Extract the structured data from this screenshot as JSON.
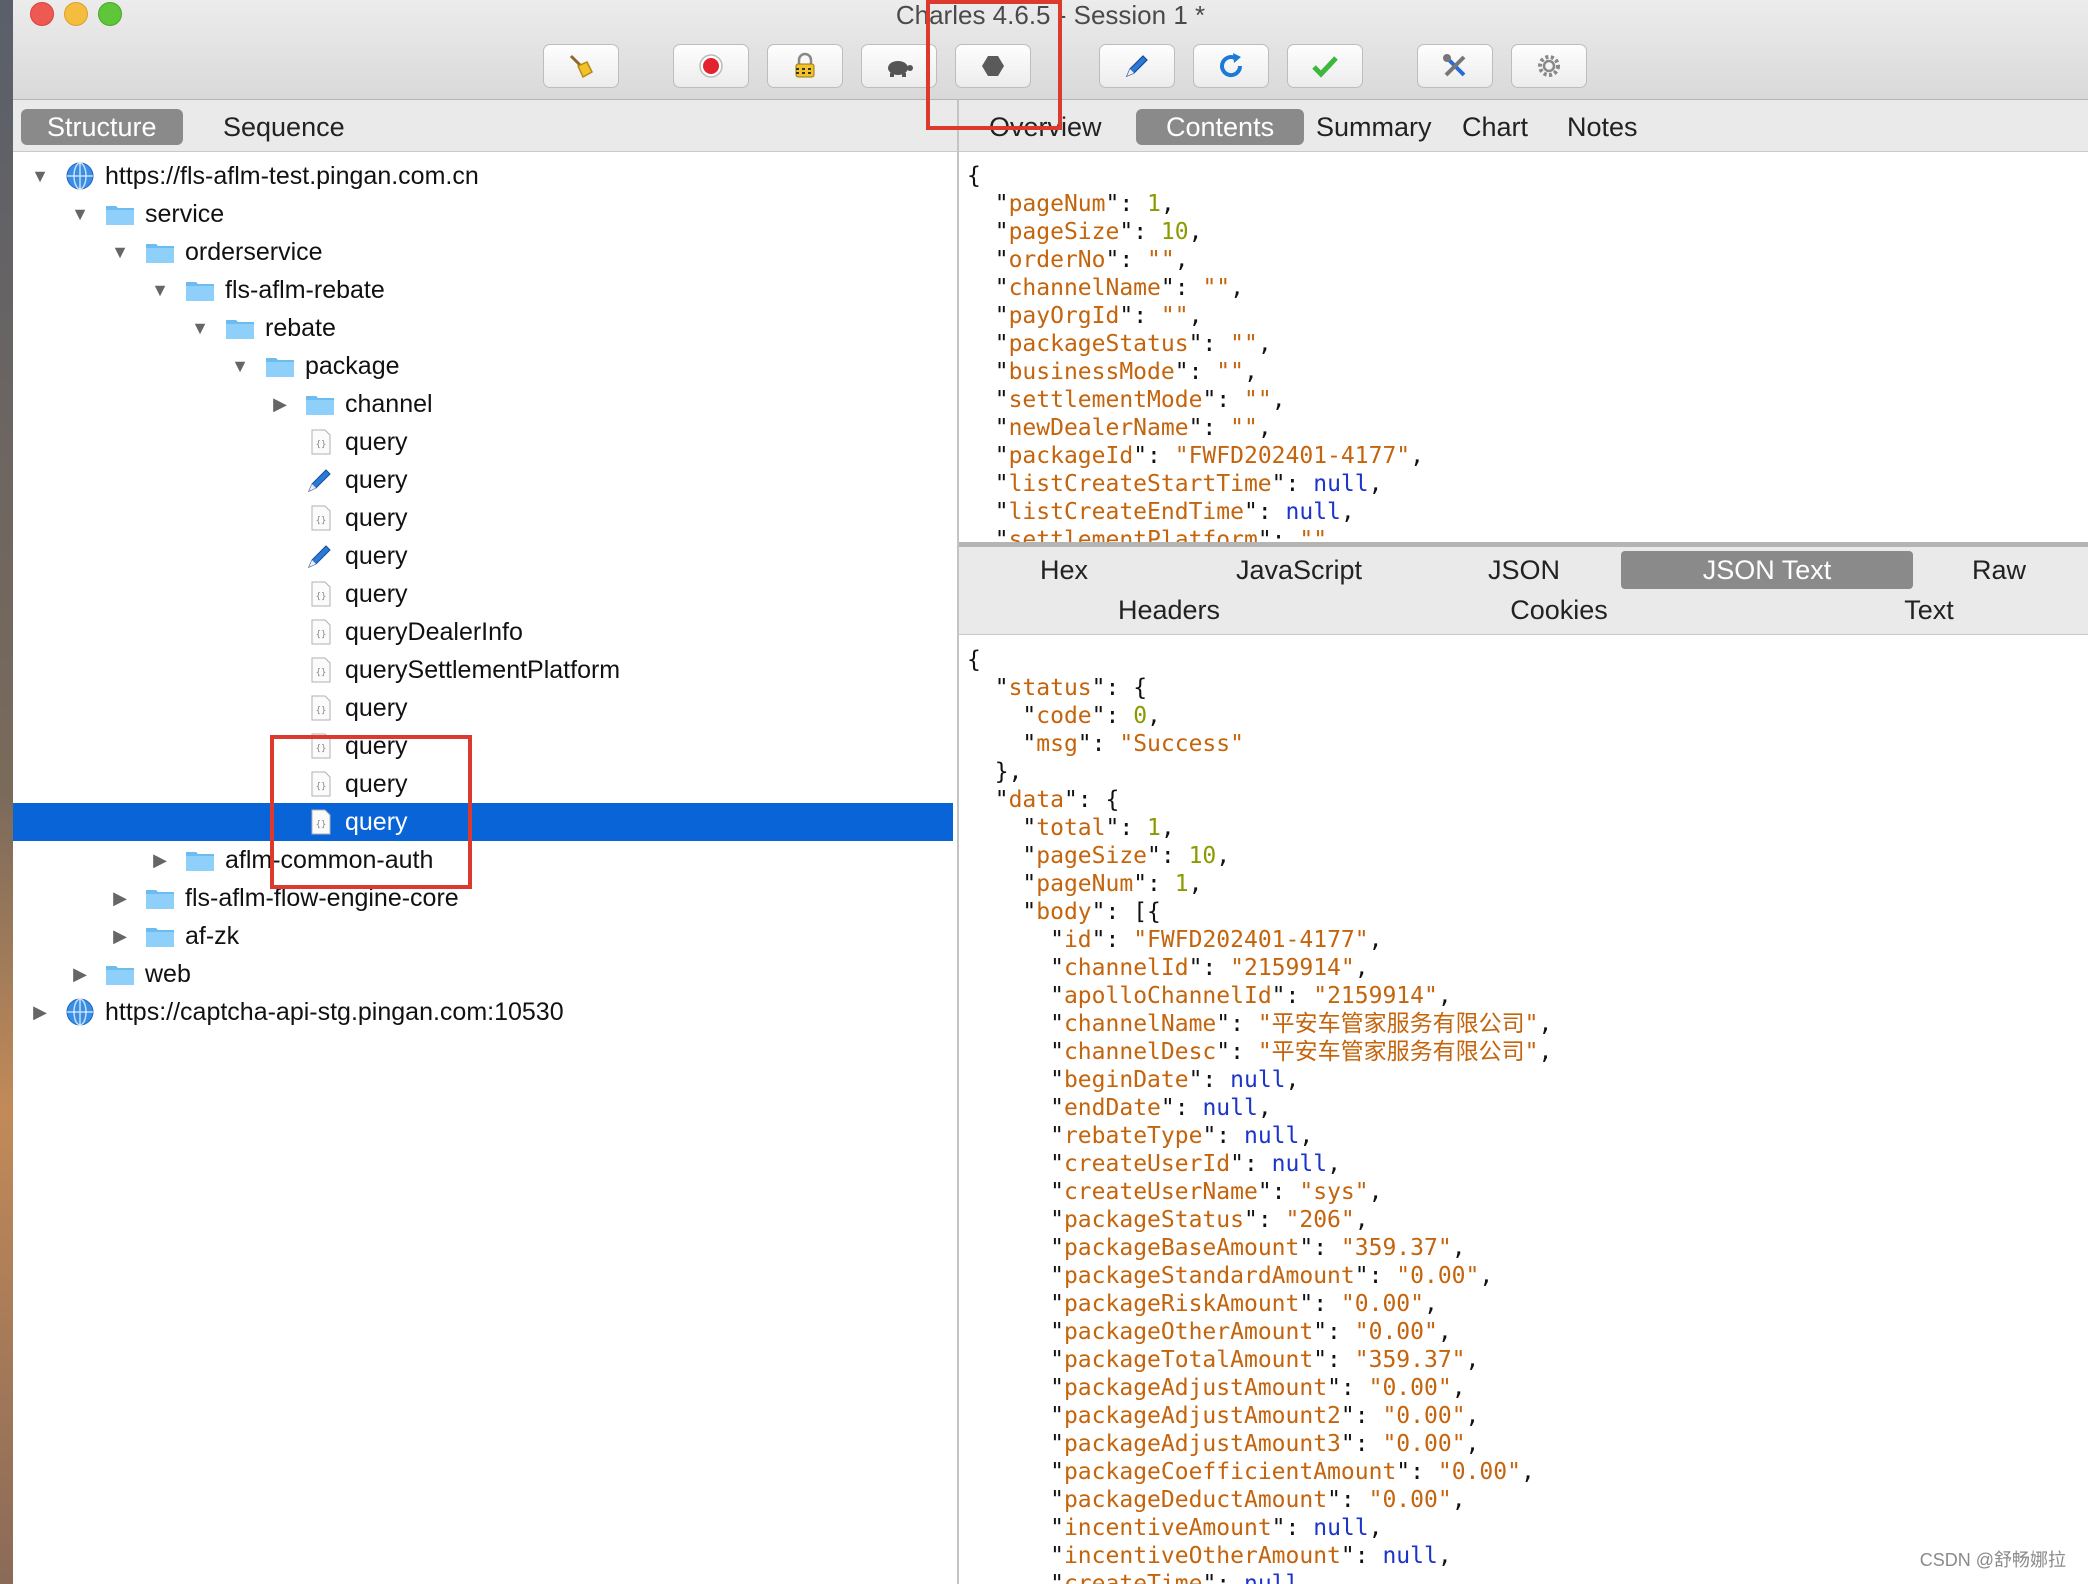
{
  "window": {
    "title": "Charles 4.6.5 - Session 1 *"
  },
  "left_tabs": [
    "Structure",
    "Sequence"
  ],
  "right_tabs": [
    "Overview",
    "Contents",
    "Summary",
    "Chart",
    "Notes"
  ],
  "toolbar": [
    "broom-icon",
    "record-icon",
    "ssl-lock-icon",
    "throttle-turtle-icon",
    "breakpoint-hexagon-icon",
    "compose-pen-icon",
    "repeat-icon",
    "validate-check-icon",
    "tools-icon",
    "settings-gear-icon"
  ],
  "tree": [
    {
      "depth": 0,
      "exp": "open",
      "icon": "globe",
      "label": "https://fls-aflm-test.pingan.com.cn"
    },
    {
      "depth": 1,
      "exp": "open",
      "icon": "folder",
      "label": "service"
    },
    {
      "depth": 2,
      "exp": "open",
      "icon": "folder",
      "label": "orderservice"
    },
    {
      "depth": 3,
      "exp": "open",
      "icon": "folder",
      "label": "fls-aflm-rebate"
    },
    {
      "depth": 4,
      "exp": "open",
      "icon": "folder",
      "label": "rebate"
    },
    {
      "depth": 5,
      "exp": "open",
      "icon": "folder",
      "label": "package"
    },
    {
      "depth": 6,
      "exp": "closed",
      "icon": "folder",
      "label": "channel"
    },
    {
      "depth": 6,
      "exp": "none",
      "icon": "json",
      "label": "query"
    },
    {
      "depth": 6,
      "exp": "none",
      "icon": "pen",
      "label": "query"
    },
    {
      "depth": 6,
      "exp": "none",
      "icon": "json",
      "label": "query"
    },
    {
      "depth": 6,
      "exp": "none",
      "icon": "pen",
      "label": "query"
    },
    {
      "depth": 6,
      "exp": "none",
      "icon": "json",
      "label": "query"
    },
    {
      "depth": 6,
      "exp": "none",
      "icon": "json",
      "label": "queryDealerInfo"
    },
    {
      "depth": 6,
      "exp": "none",
      "icon": "json",
      "label": "querySettlementPlatform"
    },
    {
      "depth": 6,
      "exp": "none",
      "icon": "json",
      "label": "query"
    },
    {
      "depth": 6,
      "exp": "none",
      "icon": "json",
      "label": "query"
    },
    {
      "depth": 6,
      "exp": "none",
      "icon": "json",
      "label": "query"
    },
    {
      "depth": 6,
      "exp": "none",
      "icon": "json",
      "label": "query",
      "selected": true
    },
    {
      "depth": 3,
      "exp": "closed",
      "icon": "folder",
      "label": "aflm-common-auth"
    },
    {
      "depth": 2,
      "exp": "closed",
      "icon": "folder",
      "label": "fls-aflm-flow-engine-core"
    },
    {
      "depth": 2,
      "exp": "closed",
      "icon": "folder",
      "label": "af-zk"
    },
    {
      "depth": 1,
      "exp": "closed",
      "icon": "folder",
      "label": "web"
    },
    {
      "depth": 0,
      "exp": "closed",
      "icon": "globe",
      "label": "https://captcha-api-stg.pingan.com:10530"
    }
  ],
  "request_json": [
    [
      "p",
      "{"
    ],
    [
      "kv",
      "pageNum",
      "1",
      "n",
      1,
      ","
    ],
    [
      "kv",
      "pageSize",
      "10",
      "n",
      1,
      ","
    ],
    [
      "kv",
      "orderNo",
      "\"\"",
      "s",
      1,
      ","
    ],
    [
      "kv",
      "channelName",
      "\"\"",
      "s",
      1,
      ","
    ],
    [
      "kv",
      "payOrgId",
      "\"\"",
      "s",
      1,
      ","
    ],
    [
      "kv",
      "packageStatus",
      "\"\"",
      "s",
      1,
      ","
    ],
    [
      "kv",
      "businessMode",
      "\"\"",
      "s",
      1,
      ","
    ],
    [
      "kv",
      "settlementMode",
      "\"\"",
      "s",
      1,
      ","
    ],
    [
      "kv",
      "newDealerName",
      "\"\"",
      "s",
      1,
      ","
    ],
    [
      "kv",
      "packageId",
      "\"FWFD202401-4177\"",
      "s",
      1,
      ","
    ],
    [
      "kv",
      "listCreateStartTime",
      "null",
      "nl",
      1,
      ","
    ],
    [
      "kv",
      "listCreateEndTime",
      "null",
      "nl",
      1,
      ","
    ],
    [
      "kv",
      "settlementPlatform",
      "\"\"",
      "s",
      1,
      ""
    ]
  ],
  "response_tabs_row1": [
    "Hex",
    "JavaScript",
    "JSON",
    "JSON Text",
    "Raw"
  ],
  "response_tabs_row2": [
    "Headers",
    "Cookies",
    "Text"
  ],
  "response_json": [
    [
      "p",
      "{"
    ],
    [
      "ko",
      "status",
      "{",
      1
    ],
    [
      "kv",
      "code",
      "0",
      "n",
      2,
      ","
    ],
    [
      "kv",
      "msg",
      "\"Success\"",
      "s",
      2,
      ""
    ],
    [
      "p",
      "  },"
    ],
    [
      "ko",
      "data",
      "{",
      1
    ],
    [
      "kv",
      "total",
      "1",
      "n",
      2,
      ","
    ],
    [
      "kv",
      "pageSize",
      "10",
      "n",
      2,
      ","
    ],
    [
      "kv",
      "pageNum",
      "1",
      "n",
      2,
      ","
    ],
    [
      "ko",
      "body",
      "[{",
      2
    ],
    [
      "kv",
      "id",
      "\"FWFD202401-4177\"",
      "s",
      3,
      ","
    ],
    [
      "kv",
      "channelId",
      "\"2159914\"",
      "s",
      3,
      ","
    ],
    [
      "kv",
      "apolloChannelId",
      "\"2159914\"",
      "s",
      3,
      ","
    ],
    [
      "kv",
      "channelName",
      "\"平安车管家服务有限公司\"",
      "s",
      3,
      ","
    ],
    [
      "kv",
      "channelDesc",
      "\"平安车管家服务有限公司\"",
      "s",
      3,
      ","
    ],
    [
      "kv",
      "beginDate",
      "null",
      "nl",
      3,
      ","
    ],
    [
      "kv",
      "endDate",
      "null",
      "nl",
      3,
      ","
    ],
    [
      "kv",
      "rebateType",
      "null",
      "nl",
      3,
      ","
    ],
    [
      "kv",
      "createUserId",
      "null",
      "nl",
      3,
      ","
    ],
    [
      "kv",
      "createUserName",
      "\"sys\"",
      "s",
      3,
      ","
    ],
    [
      "kv",
      "packageStatus",
      "\"206\"",
      "s",
      3,
      ","
    ],
    [
      "kv",
      "packageBaseAmount",
      "\"359.37\"",
      "s",
      3,
      ","
    ],
    [
      "kv",
      "packageStandardAmount",
      "\"0.00\"",
      "s",
      3,
      ","
    ],
    [
      "kv",
      "packageRiskAmount",
      "\"0.00\"",
      "s",
      3,
      ","
    ],
    [
      "kv",
      "packageOtherAmount",
      "\"0.00\"",
      "s",
      3,
      ","
    ],
    [
      "kv",
      "packageTotalAmount",
      "\"359.37\"",
      "s",
      3,
      ","
    ],
    [
      "kv",
      "packageAdjustAmount",
      "\"0.00\"",
      "s",
      3,
      ","
    ],
    [
      "kv",
      "packageAdjustAmount2",
      "\"0.00\"",
      "s",
      3,
      ","
    ],
    [
      "kv",
      "packageAdjustAmount3",
      "\"0.00\"",
      "s",
      3,
      ","
    ],
    [
      "kv",
      "packageCoefficientAmount",
      "\"0.00\"",
      "s",
      3,
      ","
    ],
    [
      "kv",
      "packageDeductAmount",
      "\"0.00\"",
      "s",
      3,
      ","
    ],
    [
      "kv",
      "incentiveAmount",
      "null",
      "nl",
      3,
      ","
    ],
    [
      "kv",
      "incentiveOtherAmount",
      "null",
      "nl",
      3,
      ","
    ],
    [
      "kv",
      "createTime",
      "null",
      "nl",
      3,
      ","
    ]
  ],
  "watermark": "CSDN @舒畅娜拉",
  "colors": {
    "selection": "#0964d8",
    "highlight_box": "#dc3a2e",
    "tab_selected": "#8a8a8a",
    "json_key": "#c4640c",
    "json_number": "#8a9a00",
    "json_null": "#1c35c9"
  }
}
